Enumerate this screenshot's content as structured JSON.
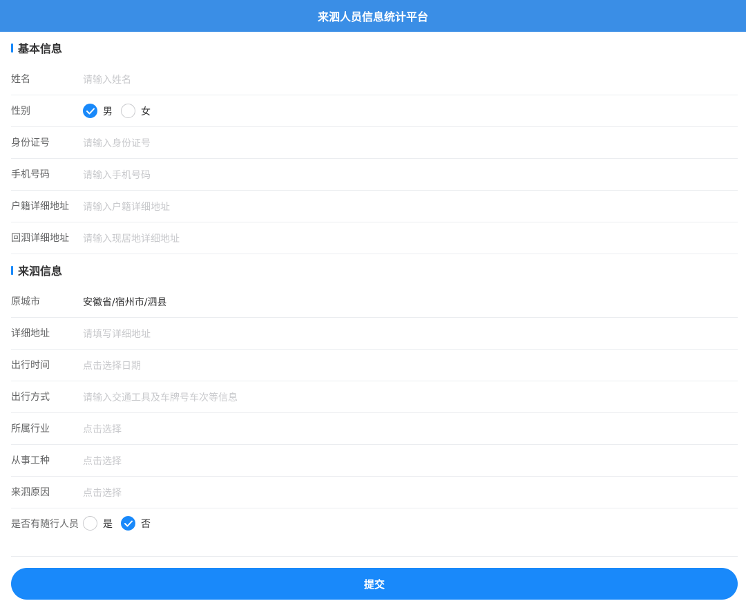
{
  "header": {
    "title": "来泗人员信息统计平台"
  },
  "basic": {
    "title": "基本信息",
    "name": {
      "label": "姓名",
      "placeholder": "请输入姓名"
    },
    "gender": {
      "label": "性别",
      "options": [
        "男",
        "女"
      ],
      "selected": "男"
    },
    "id": {
      "label": "身份证号",
      "placeholder": "请输入身份证号"
    },
    "phone": {
      "label": "手机号码",
      "placeholder": "请输入手机号码"
    },
    "home_addr": {
      "label": "户籍详细地址",
      "placeholder": "请输入户籍详细地址"
    },
    "return_addr": {
      "label": "回泗详细地址",
      "placeholder": "请输入现居地详细地址"
    }
  },
  "arrival": {
    "title": "来泗信息",
    "origin_city": {
      "label": "原城市",
      "value": "安徽省/宿州市/泗县"
    },
    "detail_addr": {
      "label": "详细地址",
      "placeholder": "请填写详细地址"
    },
    "travel_time": {
      "label": "出行时间",
      "placeholder": "点击选择日期"
    },
    "travel_mode": {
      "label": "出行方式",
      "placeholder": "请输入交通工具及车牌号车次等信息"
    },
    "industry": {
      "label": "所属行业",
      "placeholder": "点击选择"
    },
    "job": {
      "label": "从事工种",
      "placeholder": "点击选择"
    },
    "reason": {
      "label": "来泗原因",
      "placeholder": "点击选择"
    },
    "companions": {
      "label": "是否有随行人员",
      "options": [
        "是",
        "否"
      ],
      "selected": "否"
    }
  },
  "submit": {
    "label": "提交"
  },
  "colors": {
    "navbar": "#3a8ee6",
    "accent": "#1989fa"
  }
}
